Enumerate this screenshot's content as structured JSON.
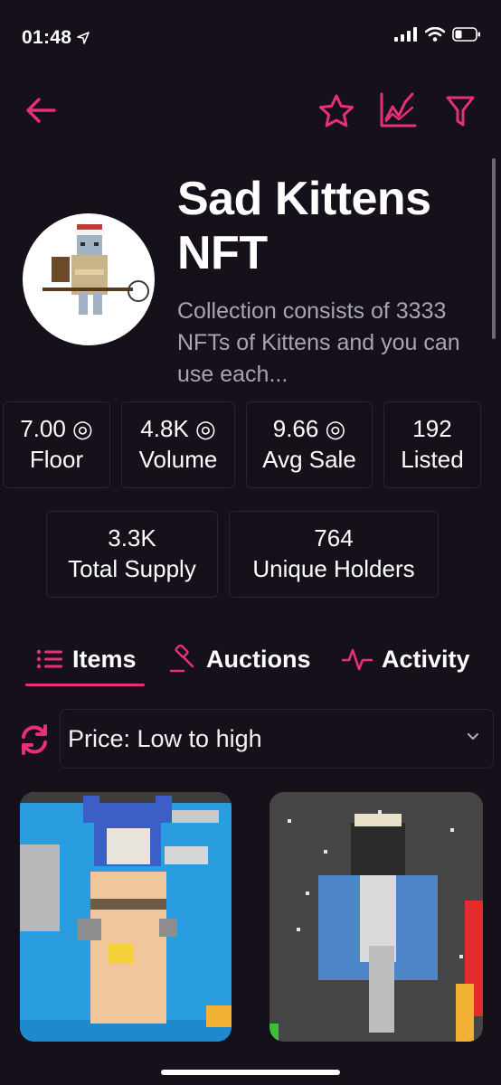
{
  "status_bar": {
    "time": "01:48"
  },
  "collection": {
    "name": "Sad Kittens NFT",
    "description": "Collection consists of 3333 NFTs of Kittens and you can use each..."
  },
  "stats": [
    {
      "value": "7.00 ◎",
      "label": "Floor"
    },
    {
      "value": "4.8K ◎",
      "label": "Volume"
    },
    {
      "value": "9.66 ◎",
      "label": "Avg Sale"
    },
    {
      "value": "192",
      "label": "Listed"
    },
    {
      "value": "3.3K",
      "label": "Total Supply"
    },
    {
      "value": "764",
      "label": "Unique Holders"
    }
  ],
  "tabs": [
    {
      "label": "Items",
      "icon": "list-icon",
      "active": true
    },
    {
      "label": "Auctions",
      "icon": "gavel-icon",
      "active": false
    },
    {
      "label": "Activity",
      "icon": "activity-icon",
      "active": false
    }
  ],
  "sort": {
    "selected": "Price: Low to high"
  },
  "icons": [
    "back-arrow-icon",
    "star-icon",
    "chart-icon",
    "filter-icon",
    "refresh-icon",
    "chevron-down-icon"
  ],
  "colors": {
    "accent": "#e8307a",
    "background": "#15101a",
    "card_border": "#2a2431",
    "muted_text": "#a8a6ad"
  }
}
